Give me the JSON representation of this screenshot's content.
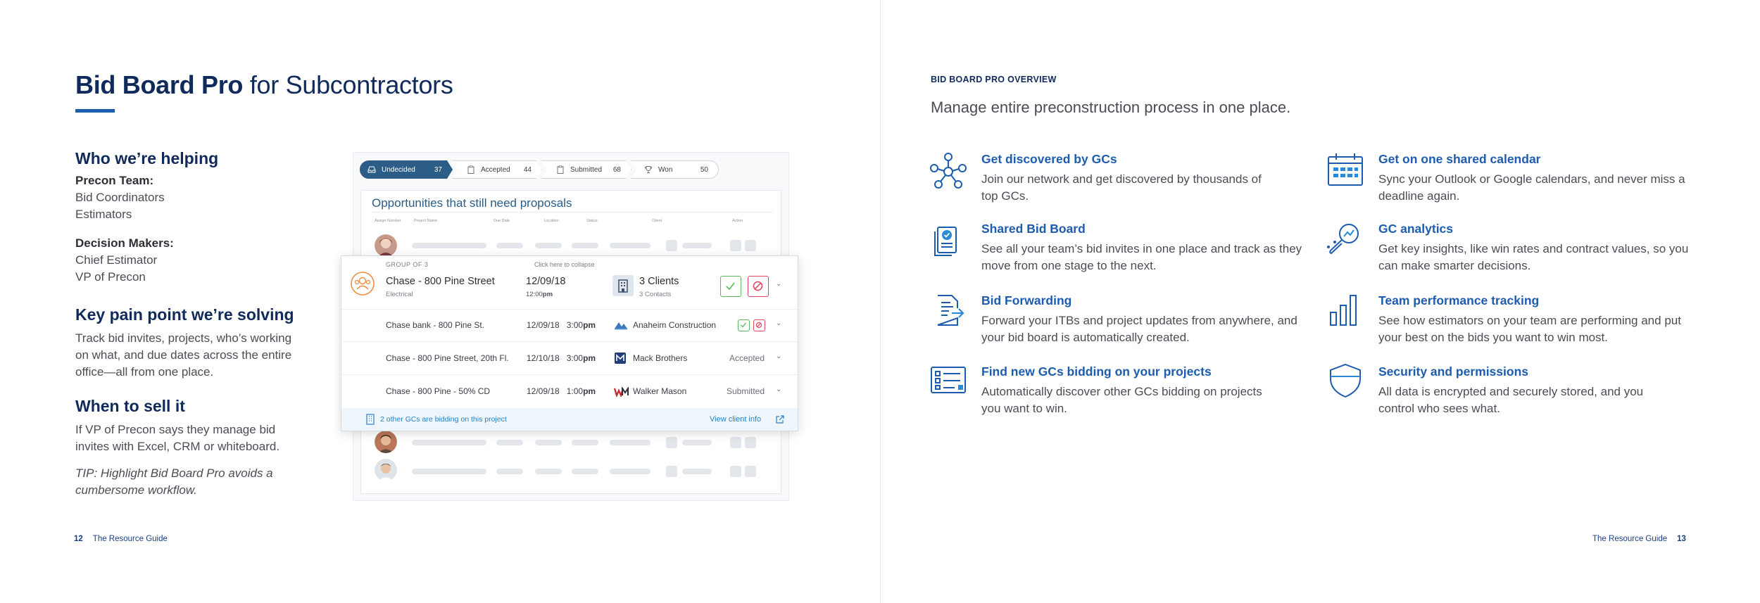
{
  "left": {
    "title_bold": "Bid Board Pro",
    "title_rest": " for Subcontractors",
    "who_heading": "Who we’re helping",
    "precon_label": "Precon Team:",
    "precon_items": [
      "Bid Coordinators",
      "Estimators"
    ],
    "decision_label": "Decision Makers:",
    "decision_items": [
      "Chief Estimator",
      "VP of Precon"
    ],
    "pain_heading": "Key pain point we’re solving",
    "pain_text": "Track bid invites, projects, who’s working on what, and due dates across the entire office—all from one place.",
    "when_heading": "When to sell it",
    "when_text": "If VP of Precon says they manage bid invites with Excel, CRM or whiteboard.",
    "tip_text": "TIP: Highlight Bid Board Pro avoids a cumbersome workflow.",
    "footer_num": "12",
    "footer_label": "The Resource Guide"
  },
  "mockup": {
    "stages": [
      {
        "label": "Undecided",
        "count": "37",
        "icon": "inbox-icon"
      },
      {
        "label": "Accepted",
        "count": "44",
        "icon": "clipboard-icon"
      },
      {
        "label": "Submitted",
        "count": "68",
        "icon": "clipboard-icon"
      },
      {
        "label": "Won",
        "count": "50",
        "icon": "trophy-icon"
      }
    ],
    "card_title": "Opportunities that still need proposals",
    "col_headers": [
      "Assign Number",
      "Project Name",
      "Due Date",
      "Location",
      "Status",
      "Client",
      "Action"
    ],
    "group": {
      "label": "GROUP OF 3",
      "collapse": "Click here to collapse",
      "project": "Chase - 800 Pine Street",
      "trade": "Electrical",
      "date": "12/09/18",
      "time": "12:00",
      "time_suffix": "pm",
      "clients": "3 Clients",
      "contacts": "3 Contacts"
    },
    "rows": [
      {
        "project": "Chase bank - 800 Pine St.",
        "date": "12/09/18",
        "time": "3:00",
        "suffix": "pm",
        "client": "Anaheim Construction",
        "status": ""
      },
      {
        "project": "Chase - 800 Pine Street, 20th Fl.",
        "date": "12/10/18",
        "time": "3:00",
        "suffix": "pm",
        "client": "Mack Brothers",
        "status": "Accepted"
      },
      {
        "project": "Chase - 800 Pine - 50% CD",
        "date": "12/09/18",
        "time": "1:00",
        "suffix": "pm",
        "client": "Walker Mason",
        "status": "Submitted"
      }
    ],
    "footer_left": "2 other GCs are bidding on this project",
    "footer_right": "View client info"
  },
  "right": {
    "eyebrow": "BID BOARD PRO OVERVIEW",
    "subhead": "Manage entire preconstruction process in one place.",
    "features": [
      {
        "title": "Get discovered by GCs",
        "desc": "Join our network and get discovered by thousands of top GCs.",
        "icon": "network-icon"
      },
      {
        "title": "Shared Bid Board",
        "desc": "See all your team’s bid invites in one place and track as they move from one stage to the next.",
        "icon": "shared-documents-icon"
      },
      {
        "title": "Bid Forwarding",
        "desc": "Forward your ITBs and project updates from anywhere, and your bid board is automatically created.",
        "icon": "forward-document-icon"
      },
      {
        "title": "Find new GCs bidding on your projects",
        "desc": "Automatically discover other GCs bidding on projects you want to win.",
        "icon": "checklist-icon"
      },
      {
        "title": "Get on one shared calendar",
        "desc": "Sync your Outlook or Google calendars, and never miss a deadline again.",
        "icon": "calendar-icon"
      },
      {
        "title": "GC analytics",
        "desc": "Get key insights, like win rates and contract values, so you can make smarter decisions.",
        "icon": "analytics-magnifier-icon"
      },
      {
        "title": "Team performance tracking",
        "desc": "See how estimators on your team are performing and put your best on the bids you want to win most.",
        "icon": "bar-chart-icon"
      },
      {
        "title": "Security and permissions",
        "desc": "All data is encrypted and securely stored, and you control who sees what.",
        "icon": "shield-icon"
      }
    ],
    "footer_label": "The Resource Guide",
    "footer_num": "13"
  }
}
